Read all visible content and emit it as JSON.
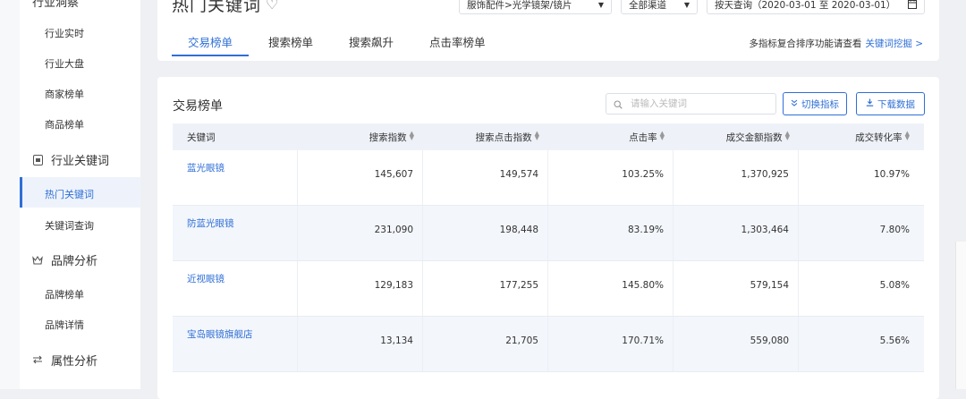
{
  "sidebar": {
    "top_cut_label": "行业洞察",
    "items": [
      {
        "label": "行业实时"
      },
      {
        "label": "行业大盘"
      },
      {
        "label": "商家榜单"
      },
      {
        "label": "商品榜单"
      }
    ],
    "groups": [
      {
        "label": "行业关键词",
        "icon": "tag-icon"
      },
      {
        "label": "品牌分析",
        "icon": "crown-icon"
      },
      {
        "label": "属性分析",
        "icon": "filter-icon"
      }
    ],
    "keyword_items": [
      {
        "label": "热门关键词",
        "active": true
      },
      {
        "label": "关键词查询"
      }
    ],
    "brand_items": [
      {
        "label": "品牌榜单"
      },
      {
        "label": "品牌详情"
      }
    ]
  },
  "header": {
    "title": "热门关键词",
    "category_select": "服饰配件>光学镜架/镜片",
    "channel_select": "全部渠道",
    "date_select": "按天查询（2020-03-01 至 2020-03-01）",
    "tabs": [
      "交易榜单",
      "搜索榜单",
      "搜索飙升",
      "点击率榜单"
    ],
    "active_tab": 0,
    "hint_text": "多指标复合排序功能请查看",
    "hint_link": "关键词挖掘 >"
  },
  "main": {
    "title": "交易榜单",
    "search_placeholder": "请输入关键词",
    "switch_button": "切换指标",
    "download_button": "下载数据",
    "columns": [
      "关键词",
      "搜索指数",
      "搜索点击指数",
      "点击率",
      "成交金额指数",
      "成交转化率"
    ],
    "rows": [
      {
        "keyword": "蓝光眼镜",
        "search_index": "145,607",
        "click_index": "149,574",
        "ctr": "103.25%",
        "gmv_index": "1,370,925",
        "cvr": "10.97%"
      },
      {
        "keyword": "防蓝光眼镜",
        "search_index": "231,090",
        "click_index": "198,448",
        "ctr": "83.19%",
        "gmv_index": "1,303,464",
        "cvr": "7.80%"
      },
      {
        "keyword": "近视眼镜",
        "search_index": "129,183",
        "click_index": "177,255",
        "ctr": "145.80%",
        "gmv_index": "579,154",
        "cvr": "5.08%"
      },
      {
        "keyword": "宝岛眼镜旗舰店",
        "search_index": "13,134",
        "click_index": "21,705",
        "ctr": "170.71%",
        "gmv_index": "559,080",
        "cvr": "5.56%"
      }
    ]
  },
  "colors": {
    "accent": "#2f6fd6",
    "background": "#eef0f3"
  }
}
